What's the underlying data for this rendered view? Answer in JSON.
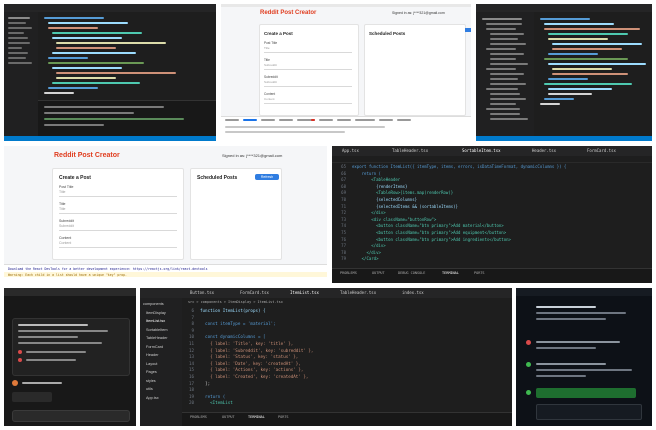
{
  "reddit_top": {
    "app_title": "Reddit Post Creator",
    "user_email": "Signed in as: j****321@gmail.com",
    "create_title": "Create a Post",
    "scheduled_title": "Scheduled Posts",
    "fields": [
      {
        "label": "Post Title",
        "placeholder": "Title"
      },
      {
        "label": "Title",
        "placeholder": "Subreddit"
      },
      {
        "label": "Subreddit",
        "placeholder": "Subreddit"
      },
      {
        "label": "Content",
        "placeholder": "Content"
      }
    ]
  },
  "reddit_mid": {
    "app_title": "Reddit Post Creator",
    "user_email": "Signed in as: j****321@gmail.com",
    "create_title": "Create a Post",
    "scheduled_title": "Scheduled Posts",
    "refresh_label": "Refresh",
    "fields": [
      {
        "label": "Post Title",
        "placeholder": "Title"
      },
      {
        "label": "Title",
        "placeholder": "Title"
      },
      {
        "label": "Subreddit",
        "placeholder": "Subreddit"
      },
      {
        "label": "Content",
        "placeholder": "Content"
      }
    ],
    "console_lines": [
      "Download the React DevTools for a better development experience: https://reactjs.org/link/react-devtools",
      "Warning: Each child in a list should have a unique \"key\" prop."
    ]
  },
  "editor_right": {
    "tabs": [
      "App.tsx",
      "TableHeader.tsx",
      "SortableItem.tsx",
      "Header.tsx",
      "FormCard.tsx"
    ],
    "lines": [
      {
        "num": "65",
        "text": "export function ItemList({ itemType, items, errors, isDataTimeFormat, dynamicColumns }) {"
      },
      {
        "num": "66",
        "text": "    return ("
      },
      {
        "num": "67",
        "text": "        <TableHeader"
      },
      {
        "num": "68",
        "text": "          {renderItems}"
      },
      {
        "num": "69",
        "text": "          <TableRow>{items.map(renderRow)}"
      },
      {
        "num": "70",
        "text": "          {selectedColumns}"
      },
      {
        "num": "71",
        "text": "          {selectedItems && (sortableItems)}"
      },
      {
        "num": "72",
        "text": "        </div>"
      },
      {
        "num": "73",
        "text": "        <div className=\"buttonRow\">"
      },
      {
        "num": "74",
        "text": "          <button className=\"btn primary\">Add material</button>"
      },
      {
        "num": "75",
        "text": "          <button className=\"btn primary\">Add equipment</button>"
      },
      {
        "num": "76",
        "text": "          <button className=\"btn primary\">Add ingredients</button>"
      },
      {
        "num": "77",
        "text": "        </div>"
      },
      {
        "num": "78",
        "text": "      </div>"
      },
      {
        "num": "79",
        "text": "    </Card>"
      }
    ],
    "status_items": [
      "PROBLEMS",
      "OUTPUT",
      "DEBUG CONSOLE",
      "TERMINAL",
      "PORTS"
    ]
  },
  "editor_bottom": {
    "tabs": [
      "Button.tsx",
      "FormCard.tsx",
      "ItemList.tsx",
      "TableHeader.tsx",
      "index.tsx"
    ],
    "breadcrumb": "src > components > ItemDisplay > ItemList.tsx",
    "explorer_items": [
      "components",
      "ItemDisplay",
      "ItemList.tsx",
      "SortableItem",
      "TableHeader",
      "FormCard",
      "Header",
      "Layout",
      "Pages",
      "styles",
      "utils",
      "App.tsx"
    ],
    "lines": [
      {
        "num": "6",
        "text": "function ItemList(props) {"
      },
      {
        "num": "7",
        "text": ""
      },
      {
        "num": "8",
        "text": "  const itemType = 'material';"
      },
      {
        "num": "9",
        "text": ""
      },
      {
        "num": "10",
        "text": "  const dynamicColumns = ["
      },
      {
        "num": "11",
        "text": "    { label: 'Title', key: 'title' },"
      },
      {
        "num": "12",
        "text": "    { label: 'Subreddit', key: 'subreddit' },"
      },
      {
        "num": "13",
        "text": "    { label: 'Status', key: 'status' },"
      },
      {
        "num": "14",
        "text": "    { label: 'Date', key: 'createdAt' },"
      },
      {
        "num": "15",
        "text": "    { label: 'Actions', key: 'actions' },"
      },
      {
        "num": "16",
        "text": "    { label: 'Created', key: 'createdAt' },"
      },
      {
        "num": "17",
        "text": "  ];"
      },
      {
        "num": "18",
        "text": ""
      },
      {
        "num": "19",
        "text": "  return ("
      },
      {
        "num": "20",
        "text": "    <ItemList"
      }
    ],
    "panel_tabs": [
      "PROBLEMS",
      "OUTPUT",
      "TERMINAL",
      "PORTS"
    ]
  },
  "colors": {
    "reddit_orange": "#e03d1f",
    "accent_blue": "#2f7de1",
    "editor_bg": "#1e1e1e"
  }
}
